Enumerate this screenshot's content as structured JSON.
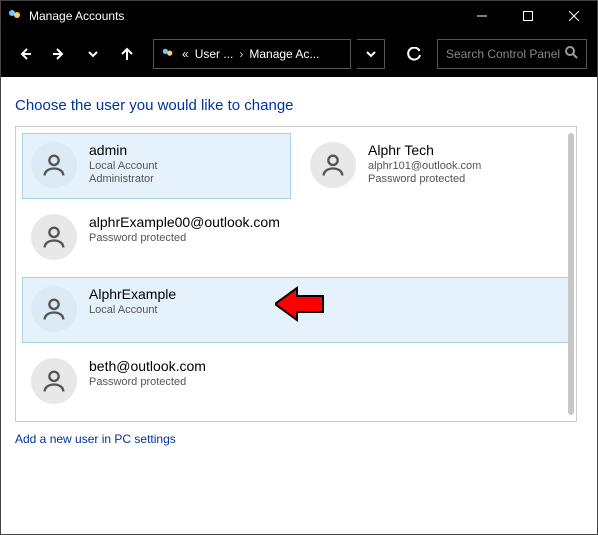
{
  "window": {
    "title": "Manage Accounts"
  },
  "breadcrumb": {
    "prefix": "«",
    "part1": "User ...",
    "part2": "Manage Ac..."
  },
  "search": {
    "placeholder": "Search Control Panel"
  },
  "heading": "Choose the user you would like to change",
  "accounts": [
    {
      "name": "admin",
      "line1": "Local Account",
      "line2": "Administrator",
      "highlight": true,
      "wide": false
    },
    {
      "name": "Alphr Tech",
      "line1": "alphr101@outlook.com",
      "line2": "Password protected",
      "highlight": false,
      "wide": false
    },
    {
      "name": "alphrExample00@outlook.com",
      "line1": "Password protected",
      "line2": "",
      "highlight": false,
      "wide": true
    },
    {
      "name": "AlphrExample",
      "line1": "Local Account",
      "line2": "",
      "highlight": true,
      "wide": true,
      "arrow": true
    },
    {
      "name": "beth@outlook.com",
      "line1": "Password protected",
      "line2": "",
      "highlight": false,
      "wide": true
    }
  ],
  "add_link": "Add a new user in PC settings"
}
